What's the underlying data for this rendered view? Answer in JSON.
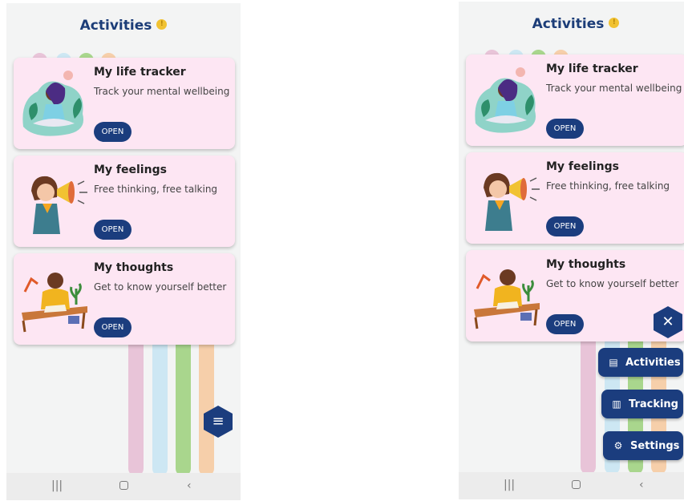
{
  "header": {
    "title": "Activities",
    "info_icon": "info-icon"
  },
  "cards": [
    {
      "title": "My life tracker",
      "subtitle": "Track your mental wellbeing",
      "button": "OPEN"
    },
    {
      "title": "My feelings",
      "subtitle": "Free thinking, free talking",
      "button": "OPEN"
    },
    {
      "title": "My thoughts",
      "subtitle": "Get to know yourself better",
      "button": "OPEN"
    }
  ],
  "menu": {
    "items": [
      {
        "label": "Activities",
        "icon": "clipboard-icon"
      },
      {
        "label": "Tracking",
        "icon": "chart-icon"
      },
      {
        "label": "Settings",
        "icon": "gear-icon"
      }
    ]
  },
  "colors": {
    "accent": "#1b3d7e",
    "card": "#fde6f3",
    "title": "#1c3d78"
  }
}
